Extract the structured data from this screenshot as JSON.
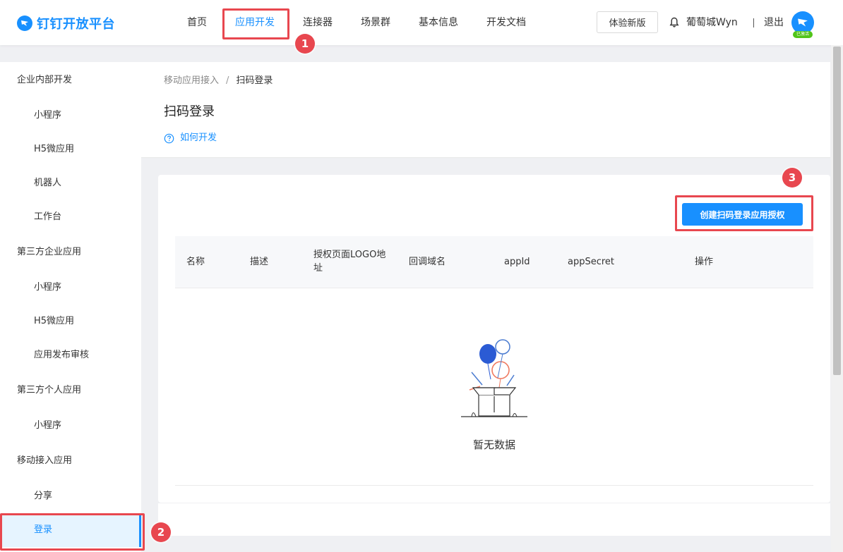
{
  "header": {
    "logo_text": "钉钉开放平台",
    "nav": [
      {
        "label": "首页",
        "active": false
      },
      {
        "label": "应用开发",
        "active": true
      },
      {
        "label": "连接器",
        "active": false
      },
      {
        "label": "场景群",
        "active": false
      },
      {
        "label": "基本信息",
        "active": false
      },
      {
        "label": "开发文档",
        "active": false
      }
    ],
    "experience_button": "体验新版",
    "username": "葡萄城Wyn",
    "logout": "退出",
    "avatar_badge": "已激活"
  },
  "sidebar": {
    "items": [
      {
        "label": "企业内部开发",
        "type": "group"
      },
      {
        "label": "小程序",
        "type": "sub"
      },
      {
        "label": "H5微应用",
        "type": "sub"
      },
      {
        "label": "机器人",
        "type": "sub"
      },
      {
        "label": "工作台",
        "type": "sub"
      },
      {
        "label": "第三方企业应用",
        "type": "group"
      },
      {
        "label": "小程序",
        "type": "sub"
      },
      {
        "label": "H5微应用",
        "type": "sub"
      },
      {
        "label": "应用发布审核",
        "type": "sub"
      },
      {
        "label": "第三方个人应用",
        "type": "group"
      },
      {
        "label": "小程序",
        "type": "sub"
      },
      {
        "label": "移动接入应用",
        "type": "group"
      },
      {
        "label": "分享",
        "type": "sub"
      },
      {
        "label": "登录",
        "type": "sub",
        "active": true
      }
    ]
  },
  "main": {
    "breadcrumb": [
      "移动应用接入",
      "扫码登录"
    ],
    "breadcrumb_separator": "/",
    "title": "扫码登录",
    "help_link": "如何开发",
    "create_button": "创建扫码登录应用授权",
    "table": {
      "columns": [
        "名称",
        "描述",
        "授权页面LOGO地址",
        "回调域名",
        "appId",
        "appSecret",
        "操作"
      ],
      "empty_text": "暂无数据"
    }
  },
  "annotations": {
    "badges": [
      "1",
      "2",
      "3"
    ],
    "color": "#e8474f"
  },
  "colors": {
    "accent": "#1890ff",
    "annotation": "#e8474f",
    "badge_green": "#52c41a"
  }
}
